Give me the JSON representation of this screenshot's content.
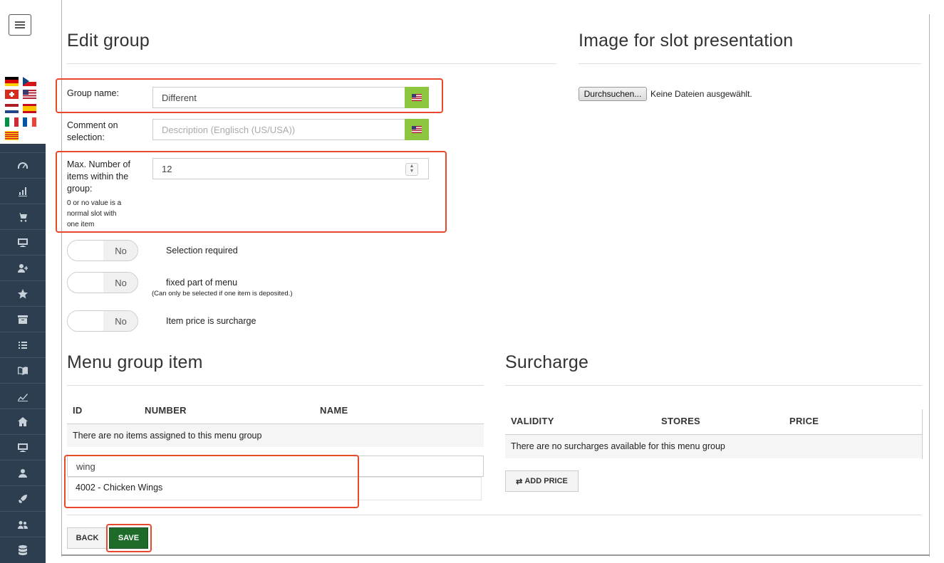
{
  "flags": [
    "de",
    "cz",
    "ch",
    "us",
    "nl",
    "es",
    "it",
    "fr",
    "ca"
  ],
  "nav_icons": [
    "dashboard-icon",
    "bar-chart-icon",
    "cart-icon",
    "monitor-icon",
    "add-user-icon",
    "star-icon",
    "archive-icon",
    "list-icon",
    "book-icon",
    "trend-icon",
    "home-icon",
    "screen-icon",
    "user-icon",
    "rocket-icon",
    "users-icon",
    "database-icon"
  ],
  "edit_group": {
    "title": "Edit group",
    "group_name_label": "Group name:",
    "group_name_value": "Different",
    "comment_label_1": "Comment on",
    "comment_label_2": "selection:",
    "comment_placeholder": "Description (Englisch (US/USA))",
    "max_label_1": "Max. Number of",
    "max_label_2": "items within the",
    "max_label_3": "group:",
    "max_hint_1": "0 or no value is a",
    "max_hint_2": "normal slot with",
    "max_hint_3": "one item",
    "max_value": "12"
  },
  "toggles": [
    {
      "state": "No",
      "label": "Selection required"
    },
    {
      "state": "No",
      "label": "fixed part of menu",
      "note": "(Can only be selected if one item is deposited.)"
    },
    {
      "state": "No",
      "label": "Item price is surcharge"
    }
  ],
  "image_section": {
    "title": "Image for slot presentation",
    "browse_button": "Durchsuchen...",
    "no_file": "Keine Dateien ausgewählt."
  },
  "menu_items": {
    "title": "Menu group item",
    "col_id": "ID",
    "col_number": "NUMBER",
    "col_name": "NAME",
    "empty": "There are no items assigned to this menu group",
    "search_value": "wing",
    "suggestion": "4002 - Chicken Wings"
  },
  "surcharge": {
    "title": "Surcharge",
    "col_validity": "VALIDITY",
    "col_stores": "STORES",
    "col_price": "PRICE",
    "empty": "There are no surcharges available for this menu group",
    "add_price": "ADD PRICE"
  },
  "actions": {
    "back": "BACK",
    "save": "SAVE"
  },
  "colors": {
    "sidebar": "#2c3e50",
    "accent_green": "#8cc63f",
    "save_green": "#1e6b2a",
    "highlight_red": "#e8482b"
  }
}
